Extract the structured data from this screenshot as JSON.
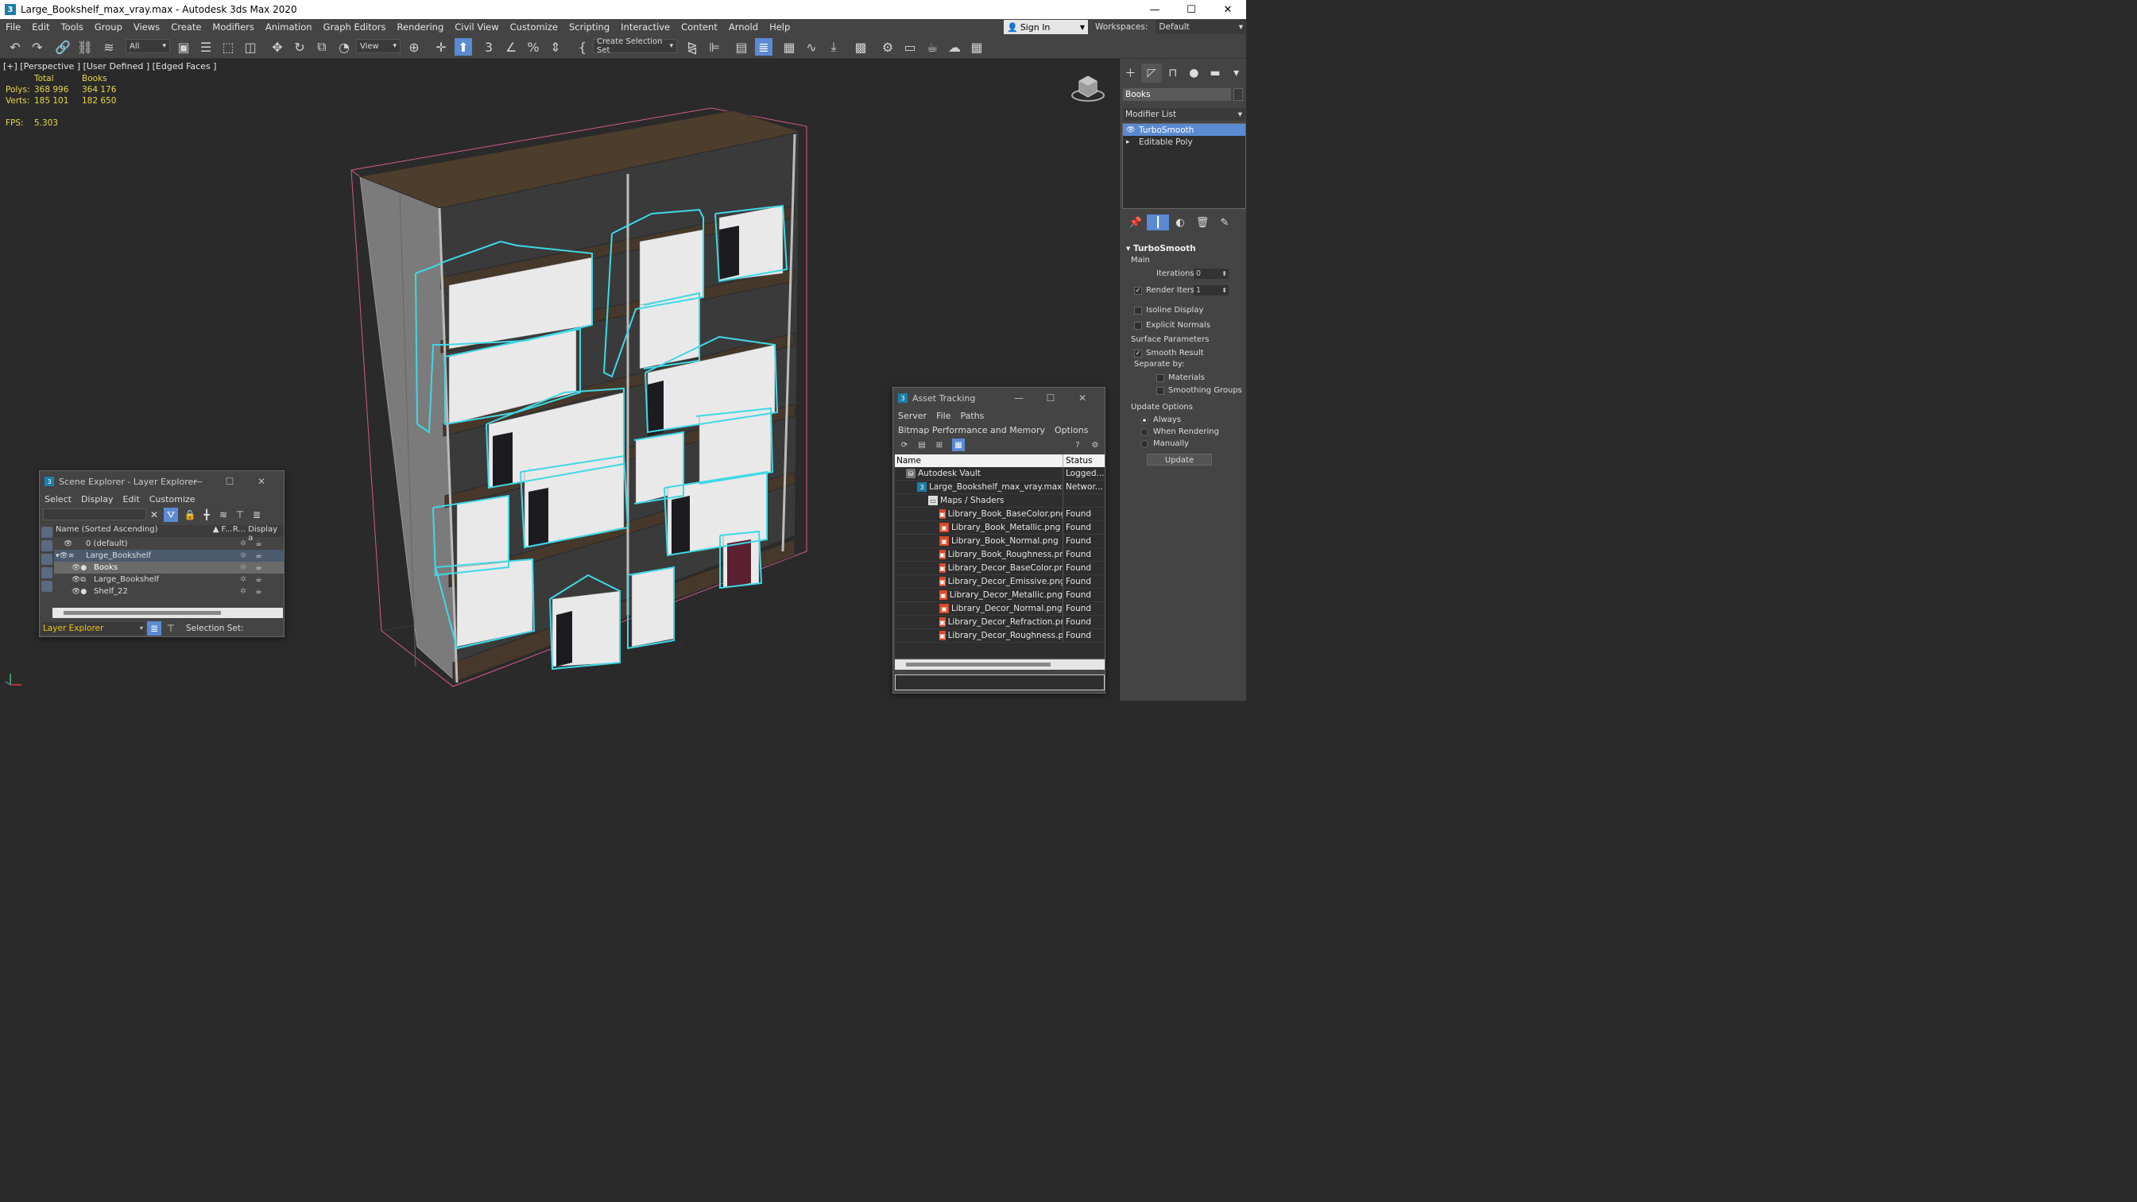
{
  "window": {
    "title": "Large_Bookshelf_max_vray.max - Autodesk 3ds Max 2020",
    "app_icon": "3",
    "minimize": "—",
    "maximize": "☐",
    "close": "✕"
  },
  "menu": [
    "File",
    "Edit",
    "Tools",
    "Group",
    "Views",
    "Create",
    "Modifiers",
    "Animation",
    "Graph Editors",
    "Rendering",
    "Civil View",
    "Customize",
    "Scripting",
    "Interactive",
    "Content",
    "Arnold",
    "Help"
  ],
  "signin": {
    "label": "Sign In"
  },
  "workspaces": {
    "label": "Workspaces:",
    "value": "Default"
  },
  "toolbar": {
    "filter_value": "All",
    "coord_value": "View",
    "selection_set_placeholder": "Create Selection Set"
  },
  "viewport": {
    "label": "[+] [Perspective ] [User Defined ] [Edged Faces ]",
    "stats": {
      "header_total": "Total",
      "header_sel": "Books",
      "polys_label": "Polys:",
      "polys_total": "368 996",
      "polys_sel": "364 176",
      "verts_label": "Verts:",
      "verts_total": "185 101",
      "verts_sel": "182 650"
    },
    "fps_label": "FPS:",
    "fps_value": "5.303",
    "colors": {
      "wood": "#4a3b2c",
      "frame": "#7d7d7d",
      "selection": "#3fd8e6",
      "pink": "#e05a8a"
    }
  },
  "command_panel": {
    "object_name": "Books",
    "modifier_list_label": "Modifier List",
    "stack": [
      {
        "label": "TurboSmooth",
        "selected": true
      },
      {
        "label": "Editable Poly",
        "selected": false
      }
    ],
    "rollout": {
      "title": "TurboSmooth",
      "main": "Main",
      "iterations_label": "Iterations:",
      "iterations_value": "0",
      "render_iters_label": "Render Iters:",
      "render_iters_value": "1",
      "isoline": "Isoline Display",
      "explicit_normals": "Explicit Normals",
      "surface_params": "Surface Parameters",
      "smooth_result": "Smooth Result",
      "separate_by": "Separate by:",
      "materials": "Materials",
      "smoothing_groups": "Smoothing Groups",
      "update_options": "Update Options",
      "always": "Always",
      "when_rendering": "When Rendering",
      "manually": "Manually",
      "update_button": "Update"
    }
  },
  "scene_explorer": {
    "title": "Scene Explorer - Layer Explorer",
    "menu": [
      "Select",
      "Display",
      "Edit",
      "Customize"
    ],
    "header_name": "Name (Sorted Ascending)",
    "header_f": "▲ F...",
    "header_r": "R...",
    "header_display": "Display a",
    "rows": [
      {
        "name": "0 (default)"
      },
      {
        "name": "Large_Bookshelf"
      },
      {
        "name": "Books"
      },
      {
        "name": "Large_Bookshelf"
      },
      {
        "name": "Shelf_22"
      }
    ],
    "layer_dropdown": "Layer Explorer",
    "selection_set_label": "Selection Set:"
  },
  "asset_tracking": {
    "title": "Asset Tracking",
    "menu1": [
      "Server",
      "File",
      "Paths"
    ],
    "menu2": [
      "Bitmap Performance and Memory",
      "Options"
    ],
    "col_name": "Name",
    "col_status": "Status",
    "rows": [
      {
        "name": "Autodesk Vault",
        "status": "Logged..."
      },
      {
        "name": "Large_Bookshelf_max_vray.max",
        "status": "Networ..."
      },
      {
        "name": "Maps / Shaders",
        "status": ""
      },
      {
        "name": "Library_Book_BaseColor.png",
        "status": "Found"
      },
      {
        "name": "Library_Book_Metallic.png",
        "status": "Found"
      },
      {
        "name": "Library_Book_Normal.png",
        "status": "Found"
      },
      {
        "name": "Library_Book_Roughness.png",
        "status": "Found"
      },
      {
        "name": "Library_Decor_BaseColor.png",
        "status": "Found"
      },
      {
        "name": "Library_Decor_Emissive.png",
        "status": "Found"
      },
      {
        "name": "Library_Decor_Metallic.png",
        "status": "Found"
      },
      {
        "name": "Library_Decor_Normal.png",
        "status": "Found"
      },
      {
        "name": "Library_Decor_Refraction.png",
        "status": "Found"
      },
      {
        "name": "Library_Decor_Roughness.png",
        "status": "Found"
      }
    ]
  }
}
